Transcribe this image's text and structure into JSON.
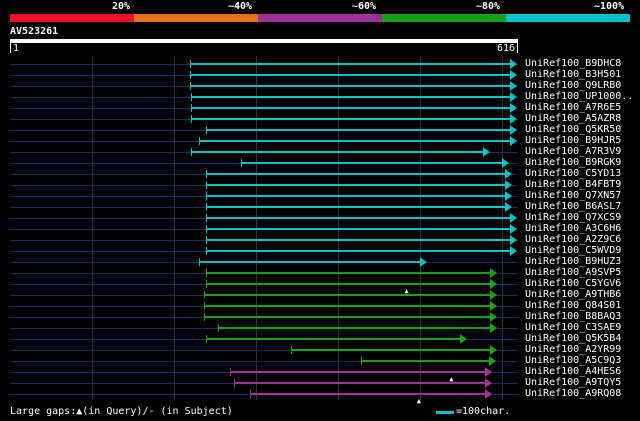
{
  "scale": {
    "labels": [
      "20%",
      "~40%",
      "~60%",
      "~80%",
      "~100%"
    ],
    "colors": [
      "#e8102a",
      "#e87018",
      "#a03098",
      "#18a018",
      "#00c0c8"
    ]
  },
  "query": {
    "name": "AV523261",
    "start_label": "1",
    "end_label": "616",
    "length": 616
  },
  "hits": [
    {
      "name": "UniRef100_B9DHC8",
      "start": 222,
      "end": 616,
      "color": "#00c0c8",
      "gap": null
    },
    {
      "name": "UniRef100_B3H501",
      "start": 222,
      "end": 616,
      "color": "#00c0c8",
      "gap": null
    },
    {
      "name": "UniRef100_Q9LRB0",
      "start": 222,
      "end": 616,
      "color": "#00c0c8",
      "gap": null
    },
    {
      "name": "UniRef100_UP1000..",
      "start": 224,
      "end": 616,
      "color": "#00c0c8",
      "gap": null
    },
    {
      "name": "UniRef100_A7R6E5",
      "start": 224,
      "end": 616,
      "color": "#00c0c8",
      "gap": null
    },
    {
      "name": "UniRef100_A5AZR8",
      "start": 224,
      "end": 616,
      "color": "#00c0c8",
      "gap": null
    },
    {
      "name": "UniRef100_Q5KR50",
      "start": 242,
      "end": 616,
      "color": "#00c0c8",
      "gap": null
    },
    {
      "name": "UniRef100_B9HJR5",
      "start": 233,
      "end": 616,
      "color": "#00c0c8",
      "gap": null
    },
    {
      "name": "UniRef100_A7R3V9",
      "start": 224,
      "end": 583,
      "color": "#00c0c8",
      "gap": null
    },
    {
      "name": "UniRef100_B9RGK9",
      "start": 285,
      "end": 606,
      "color": "#00c0c8",
      "gap": null
    },
    {
      "name": "UniRef100_C5YD13",
      "start": 242,
      "end": 610,
      "color": "#00c0c8",
      "gap": null
    },
    {
      "name": "UniRef100_B4FBT9",
      "start": 242,
      "end": 610,
      "color": "#00c0c8",
      "gap": null
    },
    {
      "name": "UniRef100_Q7XN57",
      "start": 242,
      "end": 610,
      "color": "#00c0c8",
      "gap": null
    },
    {
      "name": "UniRef100_B6ASL7",
      "start": 242,
      "end": 610,
      "color": "#00c0c8",
      "gap": null
    },
    {
      "name": "UniRef100_Q7XCS9",
      "start": 242,
      "end": 616,
      "color": "#00c0c8",
      "gap": null
    },
    {
      "name": "UniRef100_A3C6H6",
      "start": 242,
      "end": 616,
      "color": "#00c0c8",
      "gap": null
    },
    {
      "name": "UniRef100_A2Z9C6",
      "start": 242,
      "end": 616,
      "color": "#00c0c8",
      "gap": null
    },
    {
      "name": "UniRef100_C5WVD9",
      "start": 242,
      "end": 616,
      "color": "#00c0c8",
      "gap": null
    },
    {
      "name": "UniRef100_B9HUZ3",
      "start": 233,
      "end": 505,
      "color": "#00c0c8",
      "gap": null
    },
    {
      "name": "UniRef100_A9SVP5",
      "start": 242,
      "end": 592,
      "color": "#18a018",
      "gap": null
    },
    {
      "name": "UniRef100_C5YGV6",
      "start": 242,
      "end": 592,
      "color": "#18a018",
      "gap": 490
    },
    {
      "name": "UniRef100_A9THB6",
      "start": 240,
      "end": 592,
      "color": "#18a018",
      "gap": null
    },
    {
      "name": "UniRef100_Q84S01",
      "start": 240,
      "end": 592,
      "color": "#18a018",
      "gap": null
    },
    {
      "name": "UniRef100_B8BAQ3",
      "start": 240,
      "end": 592,
      "color": "#18a018",
      "gap": null
    },
    {
      "name": "UniRef100_C3SAE9",
      "start": 257,
      "end": 592,
      "color": "#18a018",
      "gap": null
    },
    {
      "name": "UniRef100_Q5K5B4",
      "start": 242,
      "end": 555,
      "color": "#18a018",
      "gap": null
    },
    {
      "name": "UniRef100_A2YR99",
      "start": 347,
      "end": 592,
      "color": "#18a018",
      "gap": null
    },
    {
      "name": "UniRef100_A5C9Q3",
      "start": 433,
      "end": 590,
      "color": "#18a018",
      "gap": null
    },
    {
      "name": "UniRef100_A4HES6",
      "start": 272,
      "end": 585,
      "color": "#a03098",
      "gap": 545
    },
    {
      "name": "UniRef100_A9TQY5",
      "start": 276,
      "end": 585,
      "color": "#a03098",
      "gap": null
    },
    {
      "name": "UniRef100_A9RQ08",
      "start": 296,
      "end": 585,
      "color": "#a03098",
      "gap": 505
    }
  ],
  "footer": {
    "legend": "Large gaps:▲(in Query)/- (in Subject)",
    "scale_label": "=100char."
  }
}
